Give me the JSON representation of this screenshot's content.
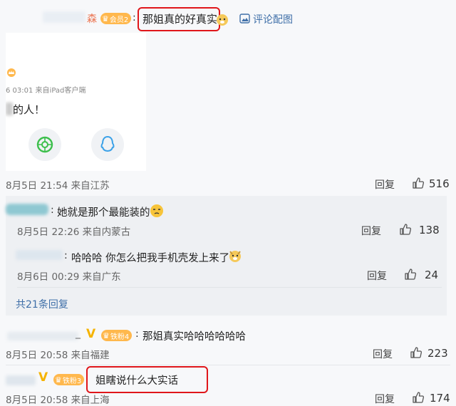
{
  "top": {
    "user_fragment": "森",
    "vip_badge": "会员2",
    "comment_text": "那姐真的好真实",
    "comment_with_image_label": "评论配图"
  },
  "image_card": {
    "date_text": "6 03:01  来自iPad客户端",
    "text": "的人！"
  },
  "comment1": {
    "meta": "8月5日 21:54 来自江苏",
    "reply": "回复",
    "likes": "516"
  },
  "sub1": {
    "text": "她就是那个最能装的",
    "meta": "8月5日 22:26 来自内蒙古",
    "reply": "回复",
    "likes": "138"
  },
  "sub2": {
    "text": "哈哈哈 你怎么把我手机壳发上来了",
    "meta": "8月6日 00:29 来自广东",
    "reply": "回复",
    "likes": "24"
  },
  "more_replies": "共21条回复",
  "comment2": {
    "vip_badge": "铁粉4",
    "text": "那姐真实哈哈哈哈哈哈",
    "meta": "8月5日 20:58 来自福建",
    "reply": "回复",
    "likes": "223"
  },
  "comment3": {
    "vip_badge": "铁粉3",
    "text": "姐瞎说什么大实话",
    "meta": "8月5日 20:58 来自上海",
    "reply": "回复",
    "likes": "174"
  },
  "colors": {
    "accent": "#eb7350",
    "highlight": "#e0161a",
    "link": "#3f6fa8",
    "vip": "#ffb84d"
  }
}
